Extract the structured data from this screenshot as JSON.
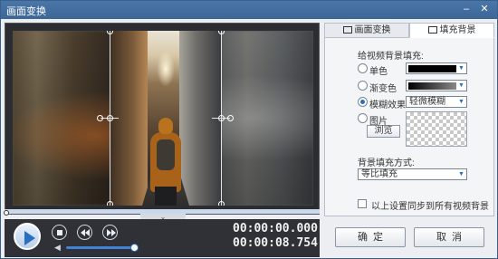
{
  "window": {
    "title": "画面变换",
    "minimize_glyph": "–",
    "close_glyph": "✕"
  },
  "tabs": [
    {
      "label": "画面变换",
      "active": false
    },
    {
      "label": "填充背景",
      "active": true
    }
  ],
  "fill_panel": {
    "section_label": "给视频背景填充:",
    "options": [
      {
        "label": "单色",
        "selected": false
      },
      {
        "label": "渐变色",
        "selected": false
      },
      {
        "label": "模糊效果",
        "selected": true
      },
      {
        "label": "图片",
        "selected": false
      }
    ],
    "solid_color": "#000000",
    "gradient_colors": [
      "#000000",
      "#888888"
    ],
    "blur_select_value": "轻微模糊",
    "browse_label": "浏览",
    "fill_mode_label": "背景填充方式:",
    "fill_mode_value": "等比填充",
    "sync_label": "以上设置同步到所有视频背景",
    "sync_checked": false
  },
  "player": {
    "current_time": "00:00:00.000",
    "total_time": "00:00:08.754",
    "volume": 1.0
  },
  "buttons": {
    "ok": "确定",
    "cancel": "取消"
  },
  "accent_color": "#2a6fc2"
}
